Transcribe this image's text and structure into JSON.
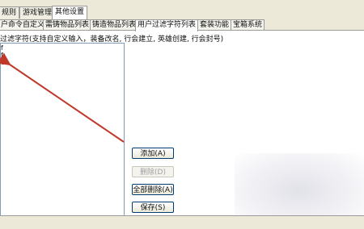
{
  "top_tabs": [
    "规则",
    "游戏管理",
    "其他设置"
  ],
  "sub_tabs": [
    "户命令自定义",
    "需铸物品列表",
    "铸造物品列表",
    "用户过滤字符列表",
    "套装功能",
    "宝箱系统"
  ],
  "hint": "过滤字符(支持自定义输入，装备改名, 行会建立, 英雄创建, 行会封号)",
  "list_items": [
    "f",
    "f",
    "c"
  ],
  "buttons": {
    "add": "添加(A)",
    "delete": "删除(D)",
    "delete_all": "全部删除(A)",
    "save": "保存(S)"
  },
  "colors": {
    "arrow": "#c0392b"
  }
}
